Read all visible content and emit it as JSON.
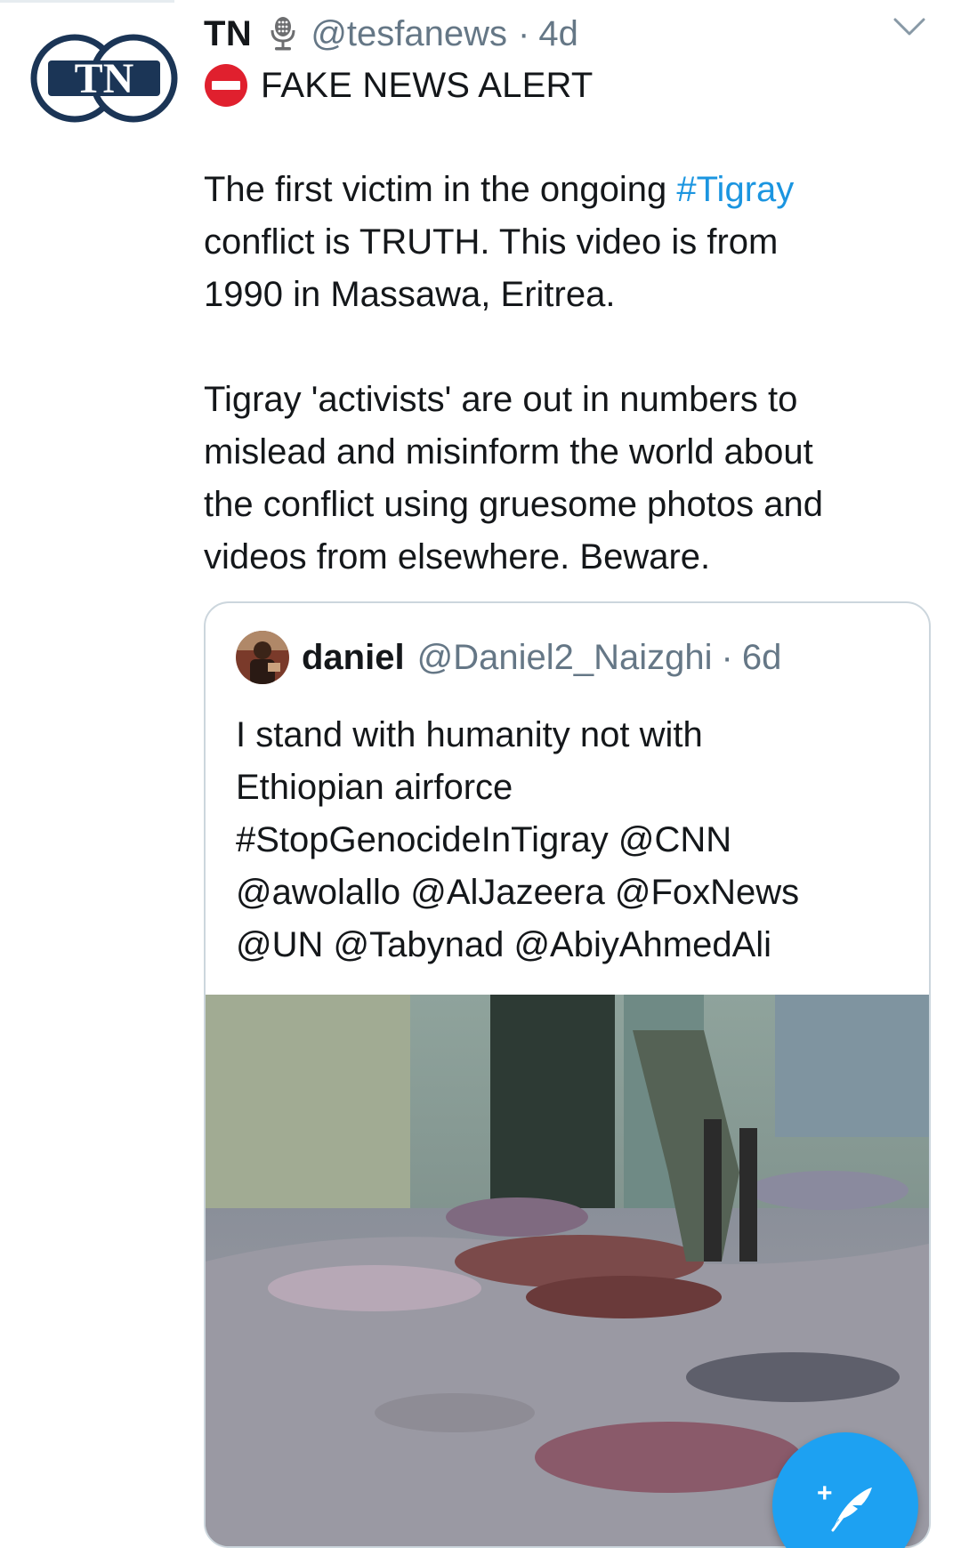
{
  "tweet": {
    "avatar_text": "TN",
    "display_name": "TN",
    "verified_icon": "microphone-icon",
    "handle": "@tesfanews",
    "separator": "·",
    "time": "4d",
    "alert_icon": "no-entry-icon",
    "alert_text": "FAKE NEWS ALERT",
    "paragraph1": {
      "line1_before": "The first victim in the ongoing ",
      "line1_hashtag": "#Tigray",
      "line2": "conflict is TRUTH. This video is from",
      "line3": "1990 in Massawa, Eritrea."
    },
    "paragraph2": {
      "line1": "Tigray 'activists' are out in numbers to",
      "line2": "mislead and misinform the world about",
      "line3": "the conflict using gruesome photos and",
      "line4": "videos from elsewhere. Beware."
    }
  },
  "quoted_tweet": {
    "display_name": "daniel",
    "handle": "@Daniel2_Naizghi",
    "separator": "·",
    "time": "6d",
    "lines": [
      "I stand with humanity not with",
      "Ethiopian airforce",
      "#StopGenocideInTigray @CNN",
      "@awolallo @AlJazeera @FoxNews",
      "@UN @Tabynad @AbiyAhmedAli"
    ]
  },
  "compose_button": {
    "icon": "compose-feather-icon",
    "plus": "+"
  },
  "colors": {
    "link": "#1b95e0",
    "secondary_text": "#657786",
    "fab": "#1da1f2",
    "logo_navy": "#1b3556",
    "alert_red": "#e0202e"
  }
}
